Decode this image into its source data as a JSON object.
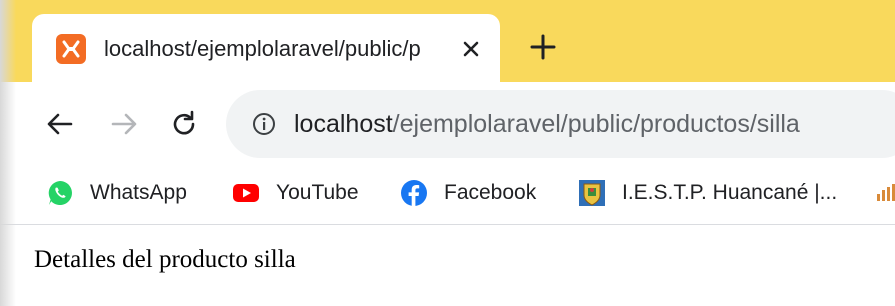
{
  "browser": {
    "tab": {
      "title": "localhost/ejemplolaravel/public/p",
      "favicon": "xampp-icon"
    },
    "new_tab_symbol": "+",
    "address_bar": {
      "url_host": "localhost",
      "url_path": "/ejemplolaravel/public/productos/silla"
    },
    "bookmarks": [
      {
        "label": "WhatsApp",
        "icon": "whatsapp-icon"
      },
      {
        "label": "YouTube",
        "icon": "youtube-icon"
      },
      {
        "label": "Facebook",
        "icon": "facebook-icon"
      },
      {
        "label": "I.E.S.T.P. Huancané |...",
        "icon": "school-crest-icon"
      }
    ]
  },
  "page": {
    "text": "Detalles del producto silla"
  },
  "colors": {
    "tabstrip": "#f9d95c",
    "omnibox": "#f1f3f4",
    "favicon": "#f36c24",
    "whatsapp": "#25d366",
    "youtube": "#ff0000",
    "facebook": "#1877f2"
  }
}
